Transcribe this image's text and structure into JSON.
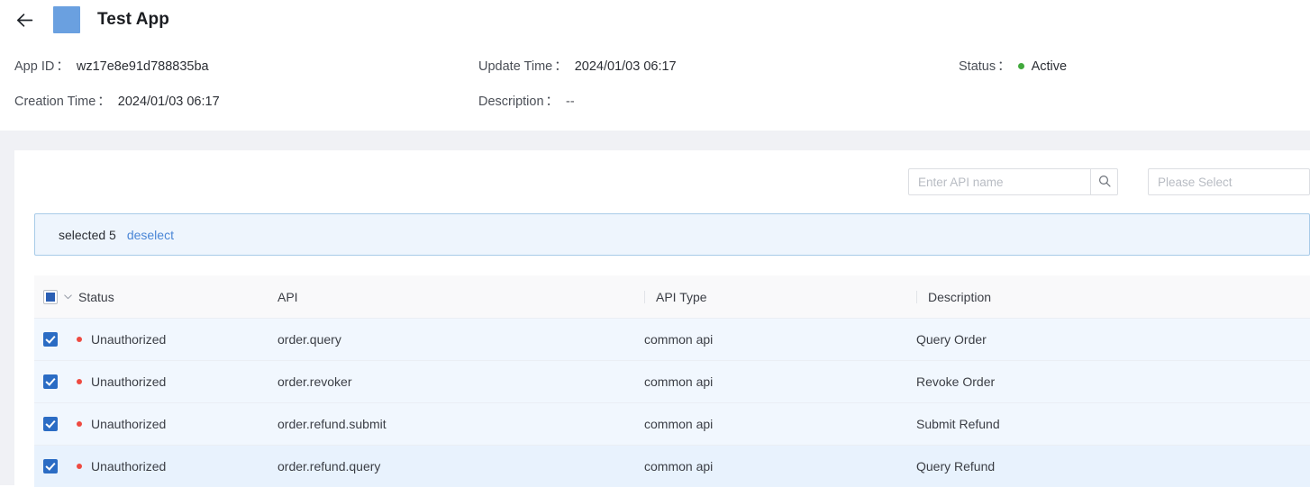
{
  "header": {
    "back_icon": "arrow-left-icon",
    "app_icon": "app-logo-icon",
    "title": "Test App",
    "fields": [
      {
        "label": "App ID",
        "colon": "：",
        "value": "wz17e8e91d788835ba"
      },
      {
        "label": "Update Time",
        "colon": "：",
        "value": "2024/01/03 06:17"
      },
      {
        "label": "Status",
        "colon": "：",
        "value": "Active",
        "dot_color": "#41a93c"
      },
      {
        "label": "Creation Time",
        "colon": "：",
        "value": "2024/01/03 06:17"
      },
      {
        "label": "Description",
        "colon": "：",
        "value": "--"
      }
    ]
  },
  "toolbar": {
    "search_placeholder": "Enter API name",
    "search_value": "",
    "search_icon": "search-icon",
    "select_placeholder": "Please Select"
  },
  "selection_banner": {
    "text": "selected 5",
    "deselect_label": "deselect",
    "accent": "#4a86d6"
  },
  "table": {
    "header_checkbox_state": "indeterminate",
    "columns": [
      {
        "key": "status",
        "label": "Status"
      },
      {
        "key": "api",
        "label": "API"
      },
      {
        "key": "type",
        "label": "API Type"
      },
      {
        "key": "description",
        "label": "Description"
      }
    ],
    "rows": [
      {
        "checked": true,
        "status": "Unauthorized",
        "api": "order.query",
        "type": "common api",
        "description": "Query Order",
        "hover": false
      },
      {
        "checked": true,
        "status": "Unauthorized",
        "api": "order.revoker",
        "type": "common api",
        "description": "Revoke Order",
        "hover": false
      },
      {
        "checked": true,
        "status": "Unauthorized",
        "api": "order.refund.submit",
        "type": "common api",
        "description": "Submit Refund",
        "hover": false
      },
      {
        "checked": true,
        "status": "Unauthorized",
        "api": "order.refund.query",
        "type": "common api",
        "description": "Query Refund",
        "hover": true
      }
    ],
    "status_dot_color": "#ee4a41"
  }
}
